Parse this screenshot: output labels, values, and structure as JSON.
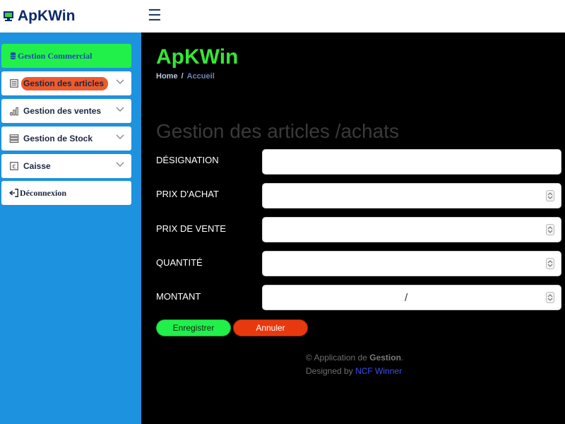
{
  "header": {
    "brand": "ApKWin",
    "menu_icon": "hamburger-icon"
  },
  "sidebar": {
    "items": [
      {
        "label": "Gestion Commercial",
        "icon": "database-icon",
        "active": true
      },
      {
        "label": "Gestion des articles",
        "icon": "list-icon",
        "highlighted": true
      },
      {
        "label": "Gestion des ventes",
        "icon": "bar-chart-icon"
      },
      {
        "label": "Gestion de Stock",
        "icon": "stock-list-icon"
      },
      {
        "label": "Caisse",
        "icon": "euro-icon"
      },
      {
        "label": "Déconnexion",
        "icon": "logout-icon"
      }
    ]
  },
  "main": {
    "title": "ApKWin",
    "breadcrumb": {
      "home": "Home",
      "separator": "/",
      "current": "Accueil"
    },
    "section_title": "Gestion des articles /achats",
    "form": {
      "designation_label": "DÉSIGNATION",
      "designation_value": "",
      "prix_achat_label": "PRIX D'ACHAT",
      "prix_achat_value": "",
      "prix_vente_label": "PRIX DE VENTE",
      "prix_vente_value": "",
      "quantite_label": "QUANTITÉ",
      "quantite_value": "",
      "montant_label": "MONTANT",
      "montant_display": "/"
    },
    "buttons": {
      "save": "Enregistrer",
      "cancel": "Annuler"
    },
    "footer": {
      "copyright": "© Application de",
      "app_word": "Gestion",
      "period": ".",
      "designed_by": "Designed by",
      "author": "NCF Winner"
    }
  },
  "colors": {
    "brand_navy": "#0b2a6a",
    "sidebar_blue": "#1d92de",
    "accent_green": "#22f04a",
    "title_green": "#37e536",
    "danger_orange": "#e8390e",
    "pill_orange": "#ef5a2d",
    "link_blue": "#3b4ff5"
  }
}
